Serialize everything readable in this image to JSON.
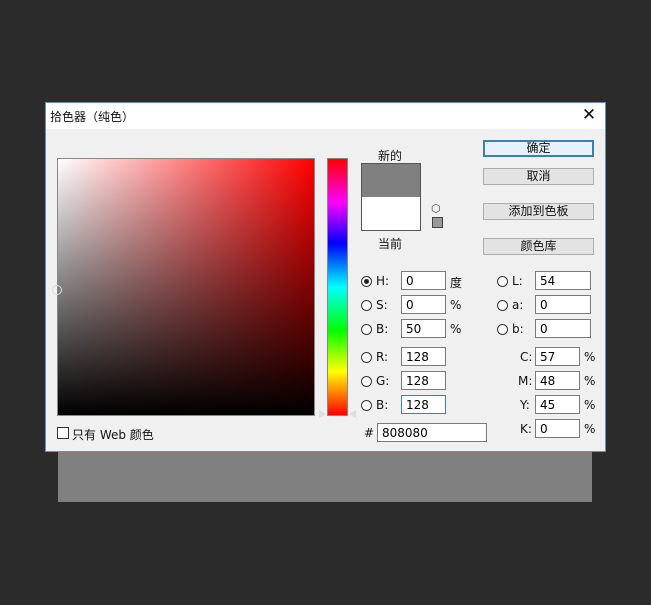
{
  "window": {
    "title": "拾色器（纯色）",
    "close_glyph": "✕"
  },
  "swatches": {
    "new_label": "新的",
    "current_label": "当前"
  },
  "buttons": {
    "ok": "确定",
    "cancel": "取消",
    "add_to_swatches": "添加到色板",
    "color_libraries": "颜色库"
  },
  "hsb": {
    "h": {
      "label": "H:",
      "value": "0",
      "unit": "度"
    },
    "s": {
      "label": "S:",
      "value": "0",
      "unit": "%"
    },
    "b": {
      "label": "B:",
      "value": "50",
      "unit": "%"
    }
  },
  "rgb": {
    "r": {
      "label": "R:",
      "value": "128"
    },
    "g": {
      "label": "G:",
      "value": "128"
    },
    "b": {
      "label": "B:",
      "value": "128"
    }
  },
  "lab": {
    "l": {
      "label": "L:",
      "value": "54"
    },
    "a": {
      "label": "a:",
      "value": "0"
    },
    "b": {
      "label": "b:",
      "value": "0"
    }
  },
  "cmyk": {
    "c": {
      "label": "C:",
      "value": "57",
      "unit": "%"
    },
    "m": {
      "label": "M:",
      "value": "48",
      "unit": "%"
    },
    "y": {
      "label": "Y:",
      "value": "45",
      "unit": "%"
    },
    "k": {
      "label": "K:",
      "value": "0",
      "unit": "%"
    }
  },
  "hex": {
    "label": "#",
    "value": "808080"
  },
  "web_only": {
    "label": "只有 Web 颜色"
  },
  "colors": {
    "new_color": "#808080",
    "current_color": "#ffffff",
    "accent": "#3c7fb1"
  }
}
